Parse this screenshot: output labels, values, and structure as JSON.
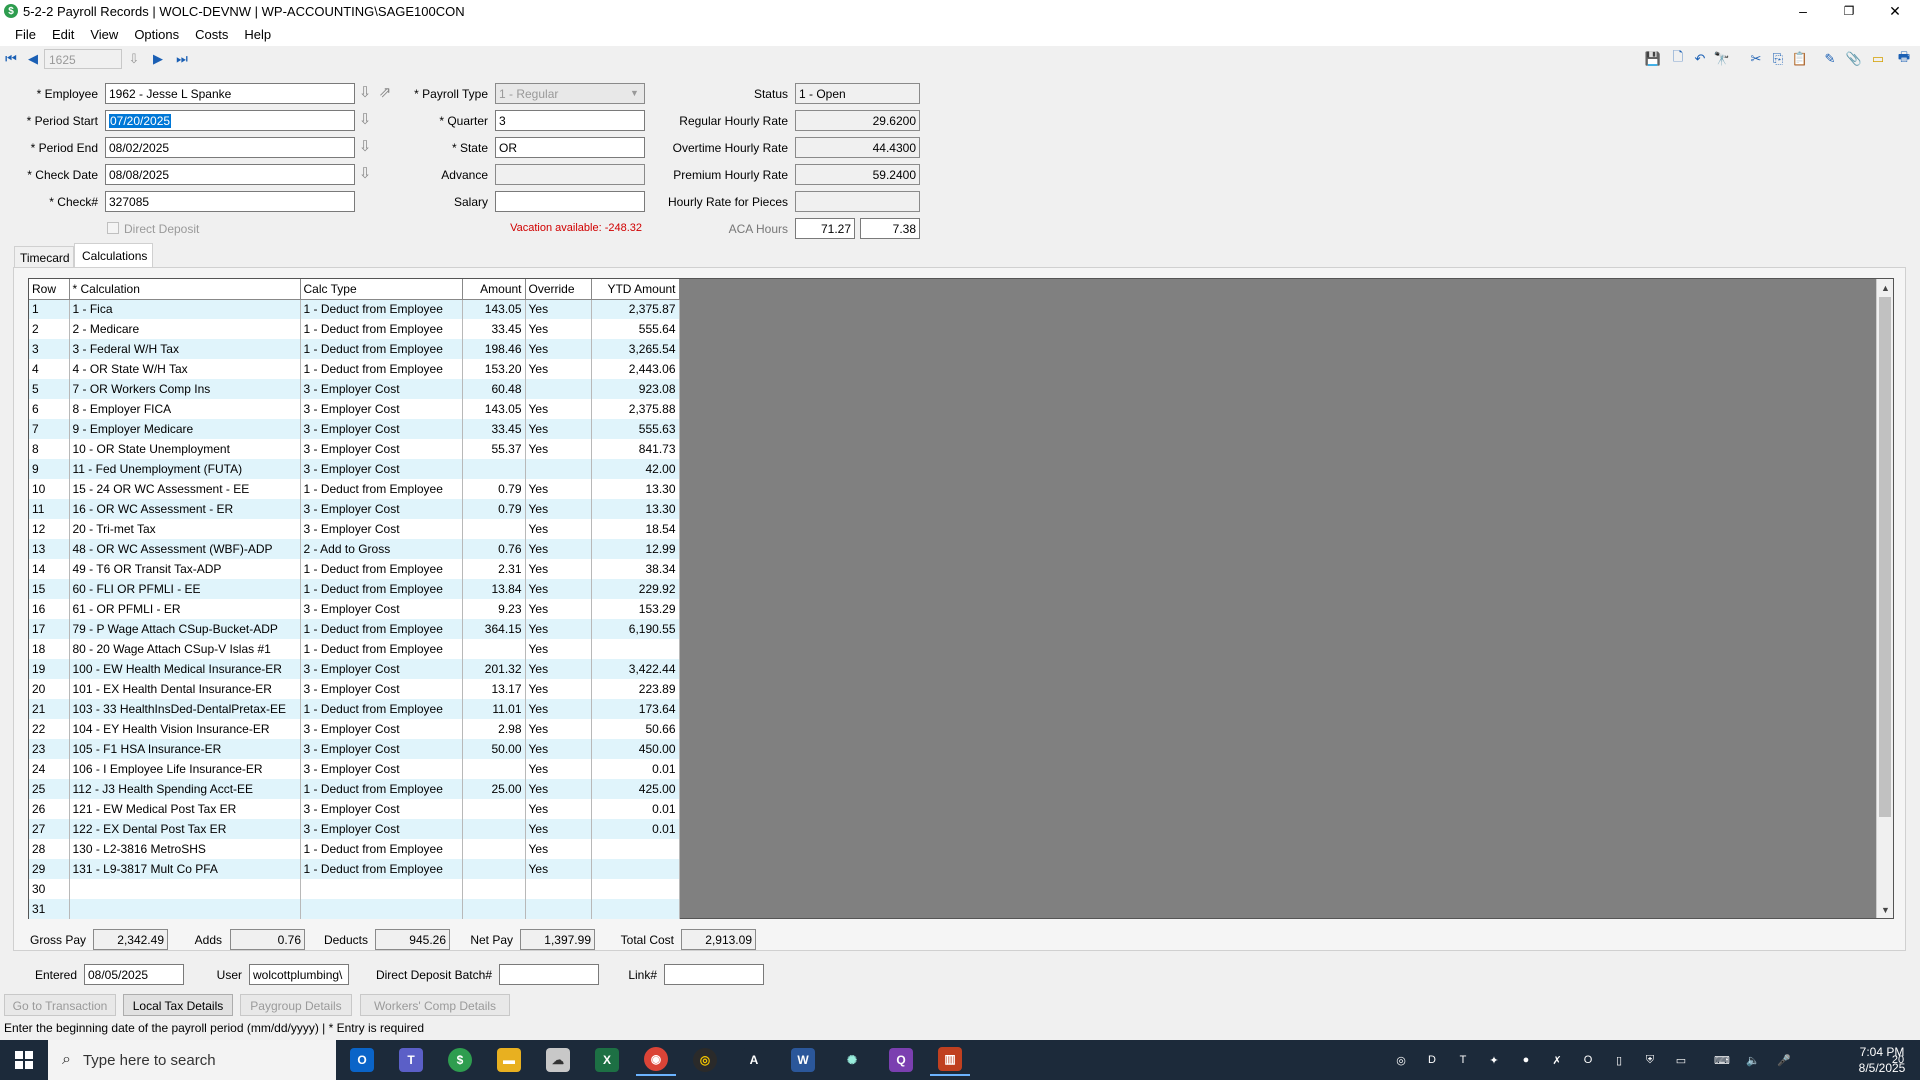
{
  "window": {
    "title": "5-2-2 Payroll Records  |  WOLC-DEVNW  |  WP-ACCOUNTING\\SAGE100CON",
    "minimize": "–",
    "restore": "❐",
    "close": "✕"
  },
  "menu": [
    "File",
    "Edit",
    "View",
    "Options",
    "Costs",
    "Help"
  ],
  "nav": {
    "record": "1625"
  },
  "form": {
    "employee_label": "* Employee",
    "employee": "1962 - Jesse L Spanke",
    "period_start_label": "* Period Start",
    "period_start": "07/20/2025",
    "period_end_label": "* Period End",
    "period_end": "08/02/2025",
    "check_date_label": "* Check Date",
    "check_date": "08/08/2025",
    "check_label": "* Check#",
    "check": "327085",
    "direct_deposit_label": "Direct Deposit",
    "payroll_type_label": "* Payroll Type",
    "payroll_type": "1 - Regular",
    "quarter_label": "* Quarter",
    "quarter": "3",
    "state_label": "* State",
    "state": "OR",
    "advance_label": "Advance",
    "advance": "",
    "salary_label": "Salary",
    "salary": "",
    "vacation_text": "Vacation available:  -248.32",
    "status_label": "Status",
    "status": "1 - Open",
    "regular_rate_label": "Regular Hourly Rate",
    "regular_rate": "29.6200",
    "overtime_rate_label": "Overtime Hourly Rate",
    "overtime_rate": "44.4300",
    "premium_rate_label": "Premium Hourly Rate",
    "premium_rate": "59.2400",
    "pieces_rate_label": "Hourly Rate for Pieces",
    "pieces_rate": "",
    "aca_label": "ACA Hours",
    "aca_hours_1": "71.27",
    "aca_hours_2": "7.38"
  },
  "tabs": [
    "Timecard",
    "Calculations"
  ],
  "grid": {
    "headers": [
      "Row",
      "* Calculation",
      "Calc Type",
      "Amount",
      "Override",
      "YTD Amount"
    ],
    "rows": [
      [
        "1",
        "1 - Fica",
        "1 - Deduct from Employee",
        "143.05",
        "Yes",
        "2,375.87"
      ],
      [
        "2",
        "2 - Medicare",
        "1 - Deduct from Employee",
        "33.45",
        "Yes",
        "555.64"
      ],
      [
        "3",
        "3 - Federal W/H Tax",
        "1 - Deduct from Employee",
        "198.46",
        "Yes",
        "3,265.54"
      ],
      [
        "4",
        "4 - OR State W/H Tax",
        "1 - Deduct from Employee",
        "153.20",
        "Yes",
        "2,443.06"
      ],
      [
        "5",
        "7 - OR Workers Comp Ins",
        "3 - Employer Cost",
        "60.48",
        "",
        "923.08"
      ],
      [
        "6",
        "8 - Employer FICA",
        "3 - Employer Cost",
        "143.05",
        "Yes",
        "2,375.88"
      ],
      [
        "7",
        "9 - Employer Medicare",
        "3 - Employer Cost",
        "33.45",
        "Yes",
        "555.63"
      ],
      [
        "8",
        "10 - OR State Unemployment",
        "3 - Employer Cost",
        "55.37",
        "Yes",
        "841.73"
      ],
      [
        "9",
        "11 - Fed Unemployment (FUTA)",
        "3 - Employer Cost",
        "",
        "",
        "42.00"
      ],
      [
        "10",
        "15 - 24 OR WC Assessment - EE",
        "1 - Deduct from Employee",
        "0.79",
        "Yes",
        "13.30"
      ],
      [
        "11",
        "16 - OR WC Assessment - ER",
        "3 - Employer Cost",
        "0.79",
        "Yes",
        "13.30"
      ],
      [
        "12",
        "20 - Tri-met Tax",
        "3 - Employer Cost",
        "",
        "Yes",
        "18.54"
      ],
      [
        "13",
        "48 - OR WC Assessment (WBF)-ADP",
        "2 - Add to Gross",
        "0.76",
        "Yes",
        "12.99"
      ],
      [
        "14",
        "49 - T6 OR Transit Tax-ADP",
        "1 - Deduct from Employee",
        "2.31",
        "Yes",
        "38.34"
      ],
      [
        "15",
        "60 - FLI OR PFMLI - EE",
        "1 - Deduct from Employee",
        "13.84",
        "Yes",
        "229.92"
      ],
      [
        "16",
        "61 - OR PFMLI - ER",
        "3 - Employer Cost",
        "9.23",
        "Yes",
        "153.29"
      ],
      [
        "17",
        "79 - P Wage Attach CSup-Bucket-ADP",
        "1 - Deduct from Employee",
        "364.15",
        "Yes",
        "6,190.55"
      ],
      [
        "18",
        "80 - 20 Wage Attach CSup-V Islas #1",
        "1 - Deduct from Employee",
        "",
        "Yes",
        ""
      ],
      [
        "19",
        "100 - EW Health Medical Insurance-ER",
        "3 - Employer Cost",
        "201.32",
        "Yes",
        "3,422.44"
      ],
      [
        "20",
        "101 - EX Health Dental Insurance-ER",
        "3 - Employer Cost",
        "13.17",
        "Yes",
        "223.89"
      ],
      [
        "21",
        "103 - 33 HealthInsDed-DentalPretax-EE",
        "1 - Deduct from Employee",
        "11.01",
        "Yes",
        "173.64"
      ],
      [
        "22",
        "104 - EY Health Vision Insurance-ER",
        "3 - Employer Cost",
        "2.98",
        "Yes",
        "50.66"
      ],
      [
        "23",
        "105 - F1 HSA Insurance-ER",
        "3 - Employer Cost",
        "50.00",
        "Yes",
        "450.00"
      ],
      [
        "24",
        "106 - I Employee Life Insurance-ER",
        "3 - Employer Cost",
        "",
        "Yes",
        "0.01"
      ],
      [
        "25",
        "112 - J3 Health Spending Acct-EE",
        "1 - Deduct from Employee",
        "25.00",
        "Yes",
        "425.00"
      ],
      [
        "26",
        "121 - EW Medical Post Tax ER",
        "3 - Employer Cost",
        "",
        "Yes",
        "0.01"
      ],
      [
        "27",
        "122 - EX Dental Post Tax ER",
        "3 - Employer Cost",
        "",
        "Yes",
        "0.01"
      ],
      [
        "28",
        "130 - L2-3816 MetroSHS",
        "1 - Deduct from Employee",
        "",
        "Yes",
        ""
      ],
      [
        "29",
        "131 - L9-3817 Mult Co PFA",
        "1 - Deduct from Employee",
        "",
        "Yes",
        ""
      ],
      [
        "30",
        "",
        "",
        "",
        "",
        ""
      ],
      [
        "31",
        "",
        "",
        "",
        "",
        ""
      ]
    ]
  },
  "totals": {
    "gross_label": "Gross Pay",
    "gross": "2,342.49",
    "adds_label": "Adds",
    "adds": "0.76",
    "deducts_label": "Deducts",
    "deducts": "945.26",
    "net_label": "Net Pay",
    "net": "1,397.99",
    "total_cost_label": "Total Cost",
    "total_cost": "2,913.09"
  },
  "footer": {
    "entered_label": "Entered",
    "entered": "08/05/2025",
    "user_label": "User",
    "user": "wolcottplumbing\\",
    "dd_batch_label": "Direct Deposit Batch#",
    "dd_batch": "",
    "link_label": "Link#",
    "link": ""
  },
  "buttons": {
    "go_to_transaction": "Go to Transaction",
    "local_tax_details": "Local Tax Details",
    "paygroup_details": "Paygroup Details",
    "workers_comp_details": "Workers' Comp Details"
  },
  "status_line": "Enter the beginning date of the payroll period (mm/dd/yyyy)  |  * Entry is required",
  "taskbar": {
    "search_placeholder": "Type here to search",
    "time": "7:04 PM",
    "date": "8/5/2025",
    "notifications": "20"
  },
  "colors": {
    "row_alt": "#e0f4fb",
    "grid_empty": "#808080",
    "vacation": "#d00000",
    "taskbar": "#1c2a3a"
  }
}
